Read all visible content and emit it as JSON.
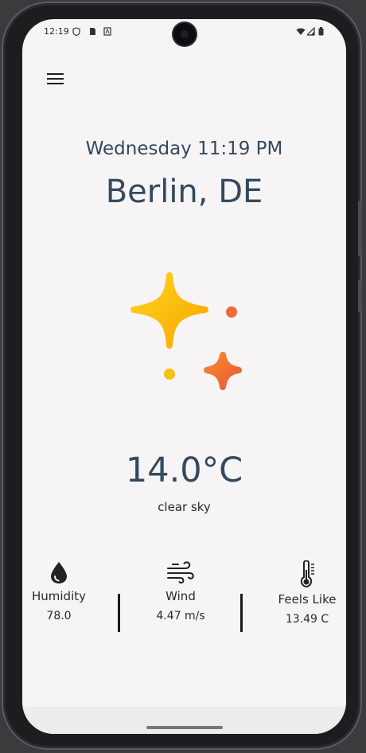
{
  "status": {
    "time": "12:19"
  },
  "header": {
    "menu_icon": "hamburger-menu-icon"
  },
  "main": {
    "datetime": "Wednesday 11:19 PM",
    "city": "Berlin, DE",
    "weather_icon": "sparkle-clear-sky-icon",
    "temperature": "14.0°C",
    "condition": "clear sky"
  },
  "metrics": [
    {
      "label": "Humidity",
      "value": "78.0",
      "icon": "water-drop-icon"
    },
    {
      "label": "Wind",
      "value": "4.47 m/s",
      "icon": "wind-icon"
    },
    {
      "label": "Feels Like",
      "value": "13.49 C",
      "icon": "thermometer-icon"
    }
  ],
  "colors": {
    "text_primary": "#34495e",
    "accent_yellow": "#f5b800",
    "accent_orange": "#ee6e35",
    "background": "#f6f4f5"
  }
}
